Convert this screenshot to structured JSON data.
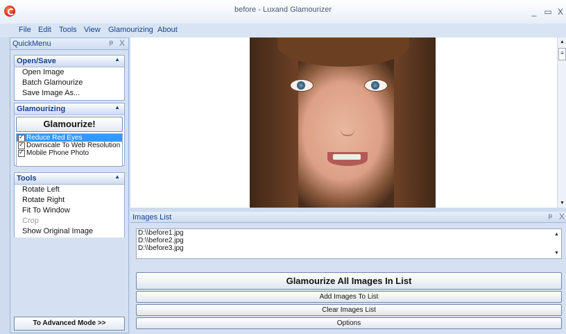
{
  "window": {
    "title": "before - Luxand Glamourizer",
    "minimize": "_",
    "maximize": "▭",
    "close": "X"
  },
  "menu": [
    "File",
    "Edit",
    "Tools",
    "View",
    "Glamourizing",
    "About"
  ],
  "quickmenu": {
    "title": "QuickMenu",
    "pin": "ᵽ",
    "close": "X",
    "open_save": {
      "title": "Open/Save",
      "items": [
        "Open Image",
        "Batch Glamourize",
        "Save Image As..."
      ]
    },
    "glamourizing": {
      "title": "Glamourizing",
      "button": "Glamourize!",
      "options": [
        {
          "label": "Reduce Red Eyes",
          "checked": true,
          "selected": true
        },
        {
          "label": "Downscale To Web Resolution",
          "checked": true,
          "selected": false
        },
        {
          "label": "Mobile Phone Photo",
          "checked": true,
          "selected": false
        }
      ]
    },
    "tools": {
      "title": "Tools",
      "items": [
        "Rotate Left",
        "Rotate Right",
        "Fit To Window",
        "Crop",
        "Show Original Image"
      ],
      "disabled": [
        "Crop"
      ]
    },
    "advanced_button": "To Advanced Mode >>"
  },
  "images_list": {
    "title": "Images List",
    "pin": "ᵽ",
    "close": "X",
    "files": [
      "D:\\\\before1.jpg",
      "D:\\\\before2.jpg",
      "D:\\\\before3.jpg"
    ],
    "glamourize_all": "Glamourize All Images In List",
    "add": "Add Images To List",
    "clear": "Clear Images List",
    "options": "Options"
  },
  "icons": {
    "app": "luxand-logo-icon",
    "photo": "portrait-photo"
  }
}
